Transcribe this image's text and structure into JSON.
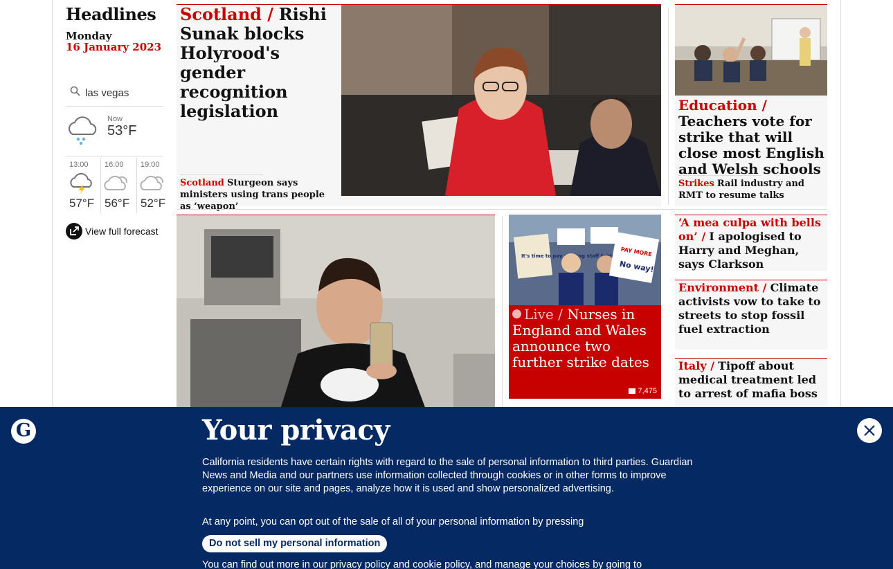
{
  "headlines": {
    "title": "Headlines",
    "day": "Monday",
    "date": "16 January 2023"
  },
  "weather": {
    "search_value": "las vegas",
    "now_label": "Now",
    "now_temp": "53°F",
    "now_icon": "rain-cloud-icon",
    "forecast": [
      {
        "time": "13:00",
        "temp": "57°F",
        "icon": "thunder-cloud-icon"
      },
      {
        "time": "16:00",
        "temp": "56°F",
        "icon": "partly-cloudy-icon"
      },
      {
        "time": "19:00",
        "temp": "52°F",
        "icon": "partly-cloudy-icon"
      }
    ],
    "view_forecast_label": "View full forecast"
  },
  "stories": {
    "lead": {
      "kicker": "Scotland /",
      "headline": "Rishi Sunak blocks Holyrood's gender recognition legislation",
      "sub_kicker": "Scotland",
      "sub_headline": "Sturgeon says ministers using trans people as ‘weapon’"
    },
    "education": {
      "kicker": "Education /",
      "headline": "Teachers vote for strike that will close most English and Welsh schools",
      "sub_kicker": "Strikes",
      "sub_headline": "Rail industry and RMT to resume talks"
    },
    "live": {
      "kicker": "Live /",
      "headline": "Nurses in England and Wales announce two further strike dates",
      "comments": "7,475",
      "placard_1": "It's time to pay nursing staff fairly",
      "placard_2": "Pay more, work longer, get less? No way!"
    },
    "clarkson": {
      "kicker": "‘A mea culpa with bells on’ /",
      "headline": "I apologised to Harry and Meghan, says Clarkson"
    },
    "environment": {
      "kicker": "Environment /",
      "headline": "Climate activists vow to take to streets to stop fossil fuel extraction"
    },
    "italy": {
      "kicker": "Italy /",
      "headline": "Tipoff about medical treatment led to arrest of mafia boss"
    }
  },
  "privacy": {
    "title": "Your privacy",
    "body": "California residents have certain rights with regard to the sale of personal information to third parties. Guardian News and Media and our partners use information collected through cookies or in other forms to improve experience on our site and pages, analyze how it is used and show personalized advertising.",
    "body2": "At any point, you can opt out of the sale of all of your personal information by pressing",
    "button_label": "Do not sell my personal information",
    "footer": "You can find out more in our privacy policy and cookie policy, and manage your choices by going to"
  },
  "colors": {
    "news_red": "#c70000",
    "brand_blue": "#052962",
    "card_bg": "#f6f6f6"
  }
}
